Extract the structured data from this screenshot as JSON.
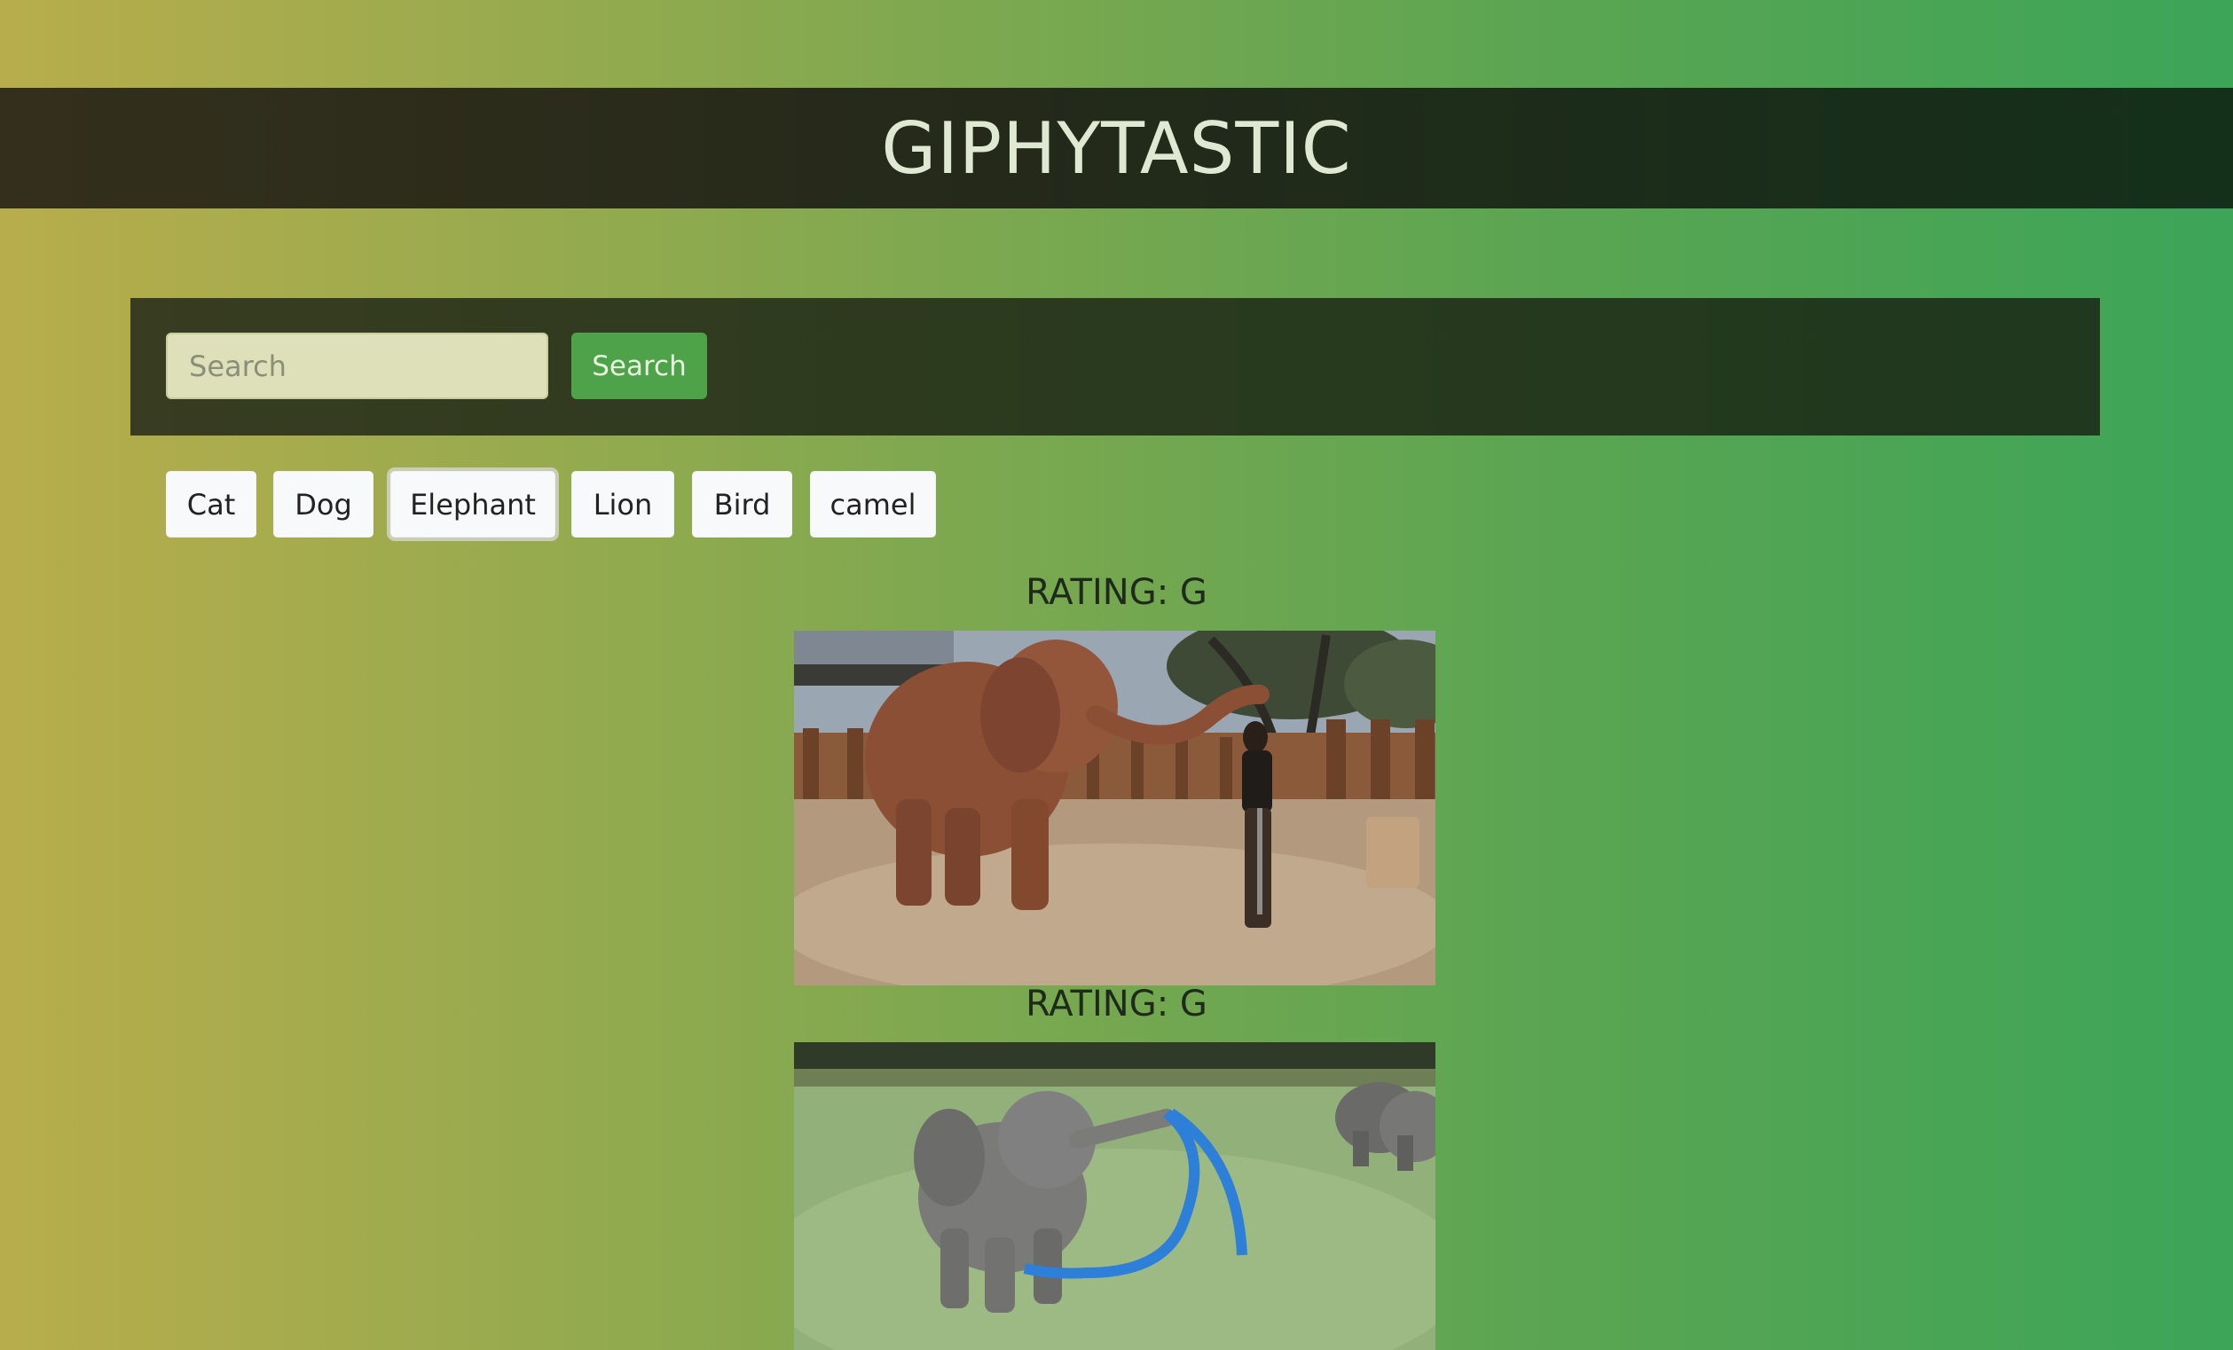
{
  "app": {
    "title": "GIPHYTASTIC"
  },
  "search": {
    "placeholder": "Search",
    "value": "",
    "button_label": "Search"
  },
  "topics": [
    {
      "label": "Cat",
      "focused": false
    },
    {
      "label": "Dog",
      "focused": false
    },
    {
      "label": "Elephant",
      "focused": true
    },
    {
      "label": "Lion",
      "focused": false
    },
    {
      "label": "Bird",
      "focused": false
    },
    {
      "label": "camel",
      "focused": false
    }
  ],
  "results": [
    {
      "rating": "RATING: G",
      "image": "elephant-with-woman-gif"
    },
    {
      "rating": "RATING: G",
      "image": "baby-elephant-with-ribbon-gif"
    }
  ],
  "colors": {
    "header_bg": "#24291a",
    "title_text": "#dfe8d2",
    "search_button": "#4ea34a",
    "topic_button": "#f8f9fa"
  }
}
